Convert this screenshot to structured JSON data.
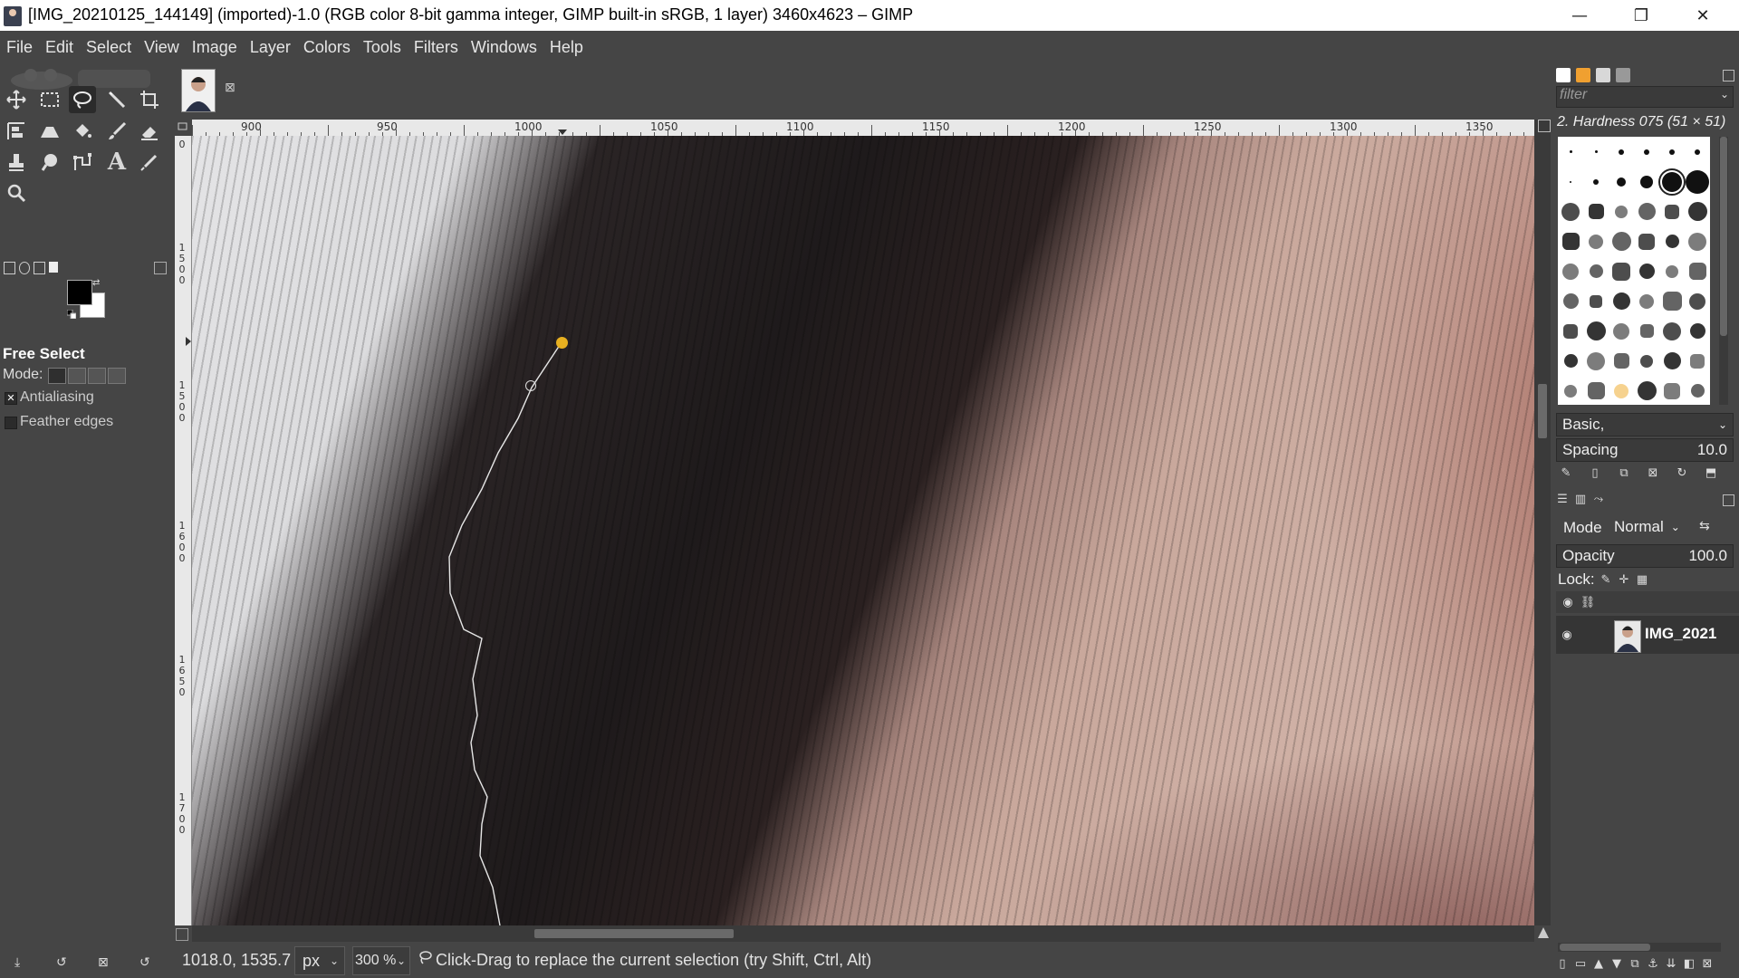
{
  "window": {
    "title": "[IMG_20210125_144149] (imported)-1.0 (RGB color 8-bit gamma integer, GIMP built-in sRGB, 1 layer) 3460x4623 – GIMP",
    "minimize_symbol": "—",
    "maximize_symbol": "❐",
    "close_symbol": "✕"
  },
  "menu": [
    "File",
    "Edit",
    "Select",
    "View",
    "Image",
    "Layer",
    "Colors",
    "Tools",
    "Filters",
    "Windows",
    "Help"
  ],
  "toolbox": {
    "tools_row1": [
      "move-icon",
      "rect-select-icon",
      "free-select-icon",
      "fuzzy-select-icon",
      "crop-icon"
    ],
    "tools_row2": [
      "align-icon",
      "transform-icon",
      "bucket-fill-icon",
      "paintbrush-icon",
      "eraser-icon"
    ],
    "tools_row3": [
      "clone-icon",
      "smudge-icon",
      "paths-icon",
      "text-icon",
      "color-picker-icon"
    ],
    "tools_row4": [
      "zoom-icon"
    ],
    "text_tool_glyph": "A"
  },
  "tool_options": {
    "title": "Free Select",
    "mode_label": "Mode:",
    "antialiasing_label": "Antialiasing",
    "antialiasing_checked": true,
    "antialiasing_mark": "✕",
    "feather_label": "Feather edges",
    "feather_checked": false
  },
  "image_tab": {
    "close_symbol": "⊠"
  },
  "rulers": {
    "h_labels": [
      "900",
      "950",
      "1000",
      "1050",
      "1100",
      "1150",
      "1200",
      "1250",
      "1300",
      "1350"
    ],
    "v_labels": [
      "0",
      "1500",
      "1600",
      "1650",
      "1700"
    ]
  },
  "status": {
    "coordinates": "1018.0, 1535.7",
    "unit": "px",
    "zoom": "300 %",
    "message": "Click-Drag to replace the current selection (try Shift, Ctrl, Alt)"
  },
  "brushes": {
    "filter_placeholder": "filter",
    "selected_brush": "2. Hardness 075 (51 × 51)",
    "preset": "Basic,",
    "spacing_label": "Spacing",
    "spacing_value": "10.0"
  },
  "layers": {
    "mode_label": "Mode",
    "mode_value": "Normal",
    "opacity_label": "Opacity",
    "opacity_value": "100.0",
    "lock_label": "Lock:",
    "layer_name": "IMG_2021"
  },
  "colors": {
    "accent_path_point": "#e8b020",
    "background": "#454545"
  }
}
